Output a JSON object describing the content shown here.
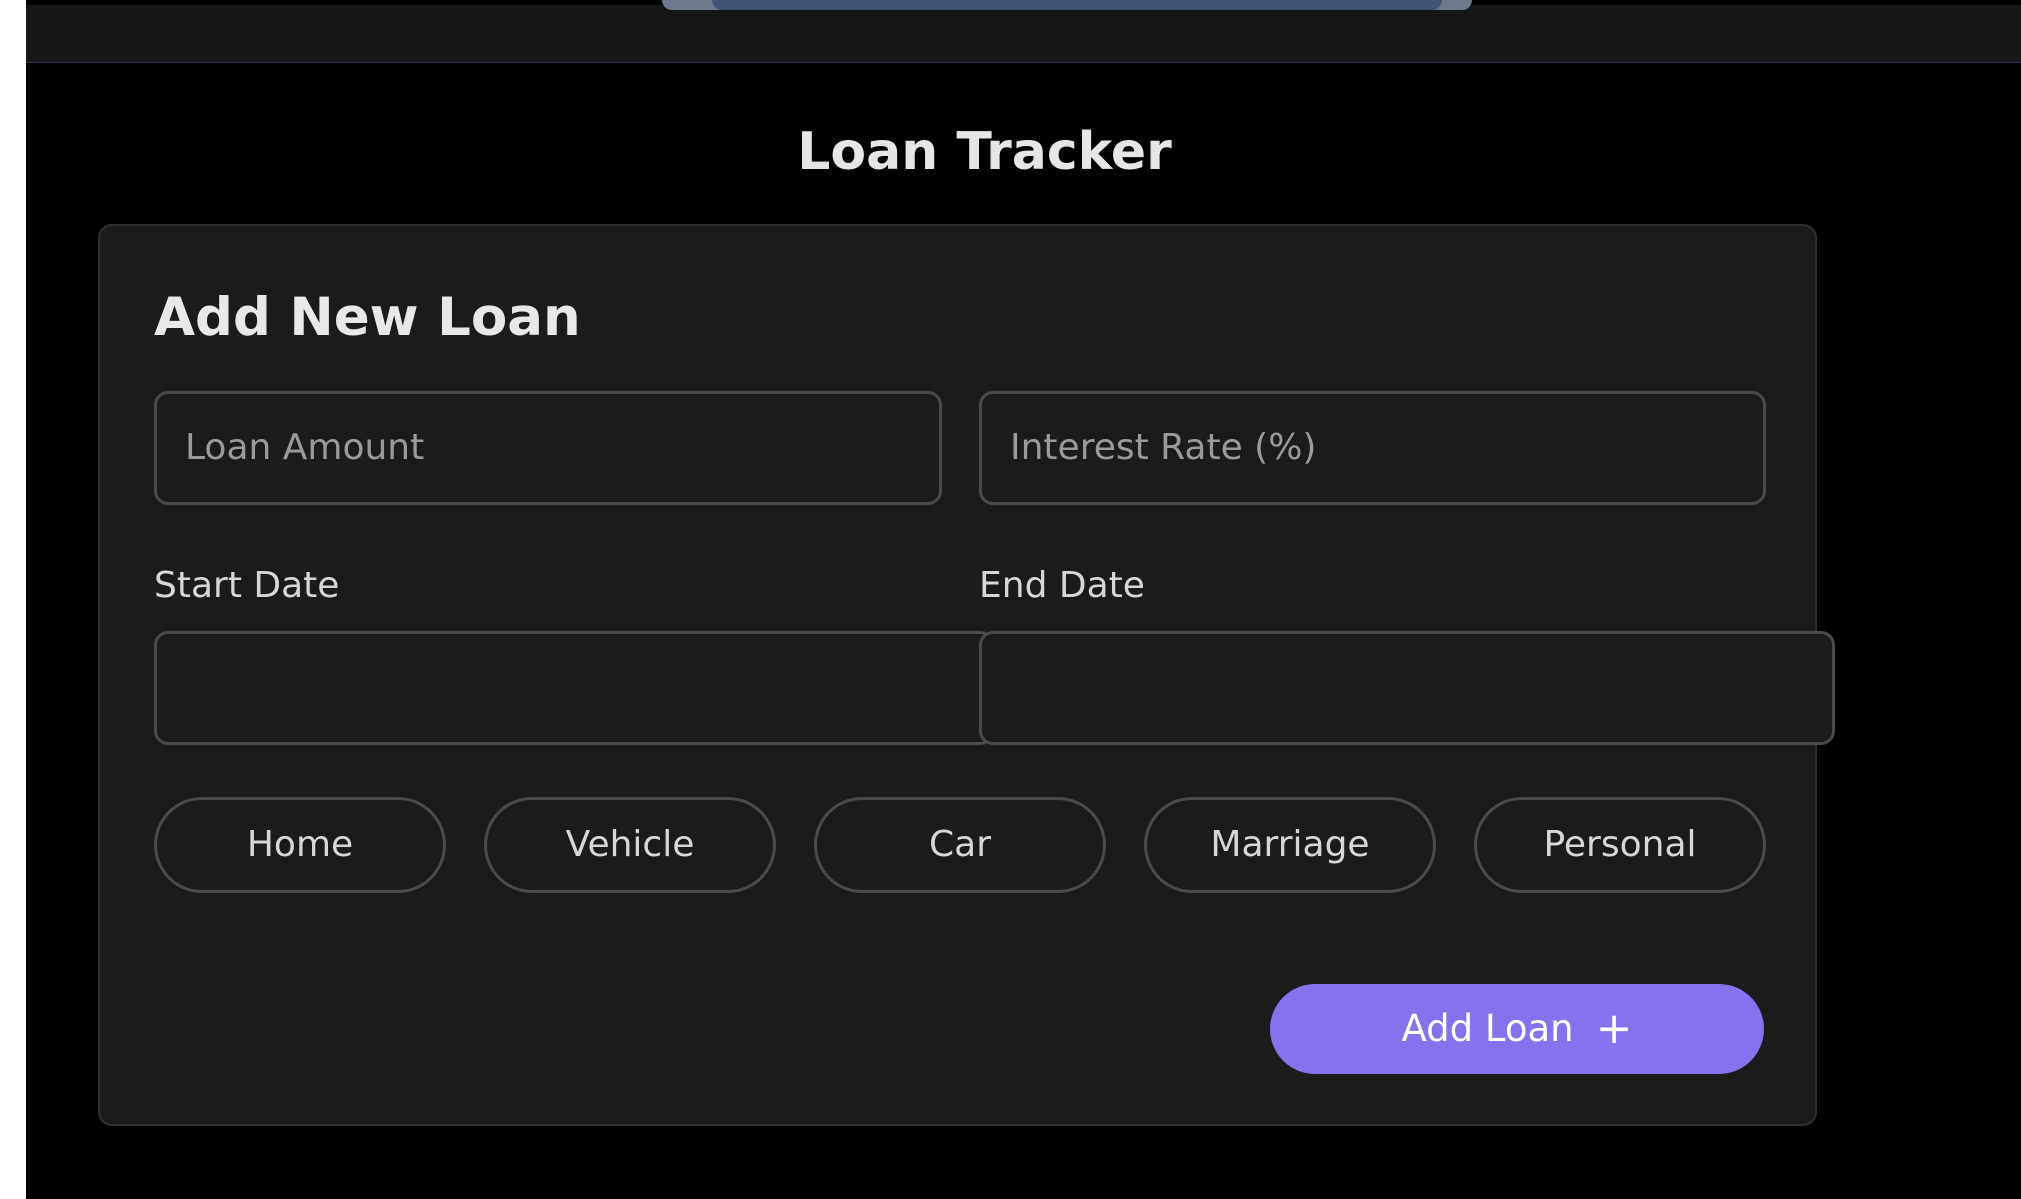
{
  "app": {
    "title": "Loan Tracker"
  },
  "form": {
    "title": "Add New Loan",
    "loan_amount": {
      "placeholder": "Loan Amount",
      "value": ""
    },
    "interest_rate": {
      "placeholder": "Interest Rate (%)",
      "value": ""
    },
    "start_date": {
      "label": "Start Date",
      "value": ""
    },
    "end_date": {
      "label": "End Date",
      "value": ""
    },
    "categories": [
      {
        "label": "Home"
      },
      {
        "label": "Vehicle"
      },
      {
        "label": "Car"
      },
      {
        "label": "Marriage"
      },
      {
        "label": "Personal"
      }
    ],
    "submit_label": "Add Loan",
    "submit_icon": "+"
  },
  "colors": {
    "page_background": "#000000",
    "card_background": "#1b1b1b",
    "accent": "#8771ed",
    "border": "#4a4a4a"
  }
}
